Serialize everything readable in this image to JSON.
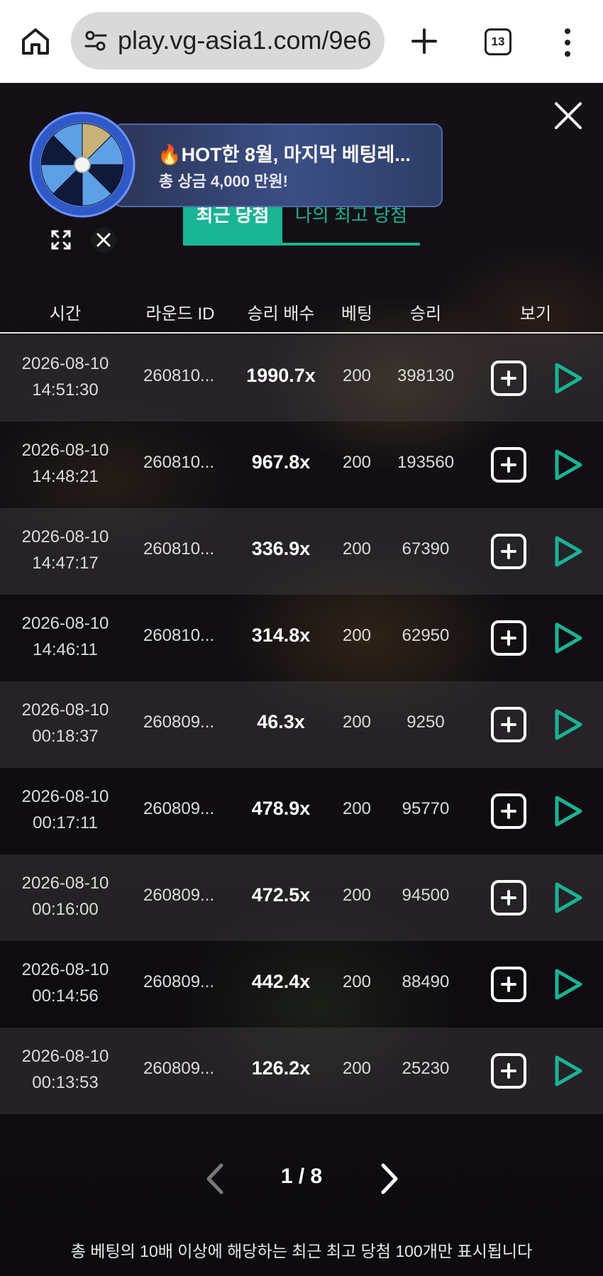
{
  "browser": {
    "url": "play.vg-asia1.com/9e6",
    "tab_count": "13"
  },
  "promo": {
    "title": "🔥HOT한 8월, 마지막 베팅레...",
    "subtitle": "총 상금 4,000 만원!"
  },
  "tabs": {
    "recent": "최근 당첨",
    "my_best": "나의 최고 당첨"
  },
  "table": {
    "headers": {
      "time": "시간",
      "round_id": "라운드 ID",
      "multiplier": "승리 배수",
      "bet": "베팅",
      "win": "승리",
      "view": "보기"
    },
    "rows": [
      {
        "date": "2026-08-10",
        "time": "14:51:30",
        "round": "260810...",
        "multiplier": "1990.7x",
        "bet": "200",
        "win": "398130"
      },
      {
        "date": "2026-08-10",
        "time": "14:48:21",
        "round": "260810...",
        "multiplier": "967.8x",
        "bet": "200",
        "win": "193560"
      },
      {
        "date": "2026-08-10",
        "time": "14:47:17",
        "round": "260810...",
        "multiplier": "336.9x",
        "bet": "200",
        "win": "67390"
      },
      {
        "date": "2026-08-10",
        "time": "14:46:11",
        "round": "260810...",
        "multiplier": "314.8x",
        "bet": "200",
        "win": "62950"
      },
      {
        "date": "2026-08-10",
        "time": "00:18:37",
        "round": "260809...",
        "multiplier": "46.3x",
        "bet": "200",
        "win": "9250"
      },
      {
        "date": "2026-08-10",
        "time": "00:17:11",
        "round": "260809...",
        "multiplier": "478.9x",
        "bet": "200",
        "win": "95770"
      },
      {
        "date": "2026-08-10",
        "time": "00:16:00",
        "round": "260809...",
        "multiplier": "472.5x",
        "bet": "200",
        "win": "94500"
      },
      {
        "date": "2026-08-10",
        "time": "00:14:56",
        "round": "260809...",
        "multiplier": "442.4x",
        "bet": "200",
        "win": "88490"
      },
      {
        "date": "2026-08-10",
        "time": "00:13:53",
        "round": "260809...",
        "multiplier": "126.2x",
        "bet": "200",
        "win": "25230"
      }
    ]
  },
  "pagination": {
    "indicator": "1 / 8"
  },
  "footnote": "총 베팅의 10배 이상에 해당하는 최근 최고 당첨 100개만 표시됩니다",
  "colors": {
    "accent": "#19b494",
    "banner": "#3b4f86",
    "background": "#0e0c10"
  },
  "icons": {
    "home": "home-icon",
    "site_settings": "tune-icon",
    "new_tab": "plus-icon",
    "menu": "more-vert-icon",
    "close": "close-icon",
    "expand": "expand-icon",
    "add": "add-square-icon",
    "play": "play-icon",
    "prev": "chevron-left-icon",
    "next": "chevron-right-icon"
  }
}
